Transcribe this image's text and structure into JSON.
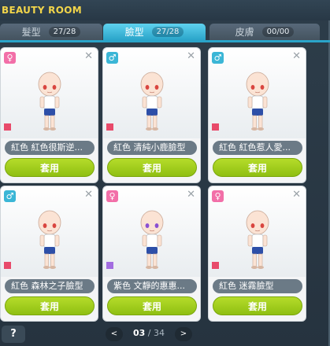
{
  "window": {
    "title": "BEAUTY ROOM"
  },
  "tabs": [
    {
      "label": "髮型",
      "count": "27/28",
      "active": false
    },
    {
      "label": "臉型",
      "count": "27/28",
      "active": true
    },
    {
      "label": "皮膚",
      "count": "00/00",
      "active": false
    }
  ],
  "cards": [
    {
      "gender": "female",
      "gender_symbol": "♀",
      "color": "#e84a6a",
      "eye_color": "#d9453f",
      "name": "紅色 紅色很斯逆...",
      "button": "套用"
    },
    {
      "gender": "male",
      "gender_symbol": "♂",
      "color": "#e84a6a",
      "eye_color": "#d9453f",
      "name": "紅色 清純小鹿臉型",
      "button": "套用"
    },
    {
      "gender": "male",
      "gender_symbol": "♂",
      "color": "#e84a6a",
      "eye_color": "#d9453f",
      "name": "紅色 紅色惹人愛...",
      "button": "套用"
    },
    {
      "gender": "male",
      "gender_symbol": "♂",
      "color": "#e84a6a",
      "eye_color": "#d9453f",
      "name": "紅色 森林之子臉型",
      "button": "套用"
    },
    {
      "gender": "female",
      "gender_symbol": "♀",
      "color": "#a36de0",
      "eye_color": "#8a4fd2",
      "name": "紫色 文靜的惠惠...",
      "button": "套用"
    },
    {
      "gender": "female",
      "gender_symbol": "♀",
      "color": "#e84a6a",
      "eye_color": "#d9453f",
      "name": "紅色 迷霧臉型",
      "button": "套用"
    }
  ],
  "footer": {
    "help": "?",
    "prev": "<",
    "next": ">",
    "page_current": "03",
    "page_sep": " / ",
    "page_total": "34"
  }
}
